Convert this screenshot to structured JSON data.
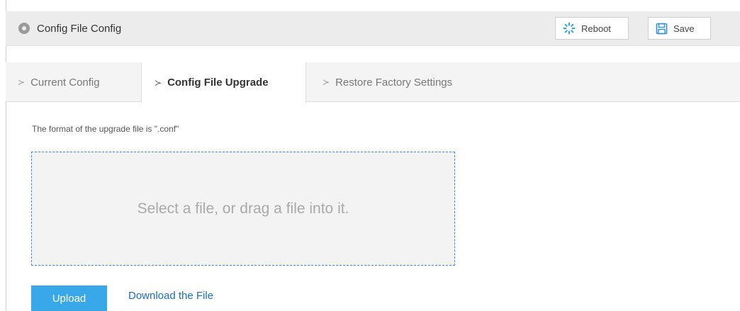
{
  "header": {
    "title": "Config File Config",
    "reboot_label": "Reboot",
    "save_label": "Save"
  },
  "tabs": [
    {
      "label": "Current Config",
      "active": false
    },
    {
      "label": "Config File Upgrade",
      "active": true
    },
    {
      "label": "Restore Factory Settings",
      "active": false
    }
  ],
  "upgrade": {
    "hint": "The format of the upgrade file is \".conf\"",
    "dropzone_text": "Select a file, or drag a file into it.",
    "upload_label": "Upload",
    "download_label": "Download the File"
  },
  "colors": {
    "accent": "#38a8e8",
    "link": "#1a6fc4",
    "dropzone_border": "#3a8bd8",
    "reboot_icon": "#2fa0e6",
    "save_icon": "#2f8fd8"
  },
  "icons": {
    "header": "settings-dot-icon",
    "reboot": "spinner-icon",
    "save": "floppy-disk-icon",
    "tab": "chevron-right-icon"
  }
}
